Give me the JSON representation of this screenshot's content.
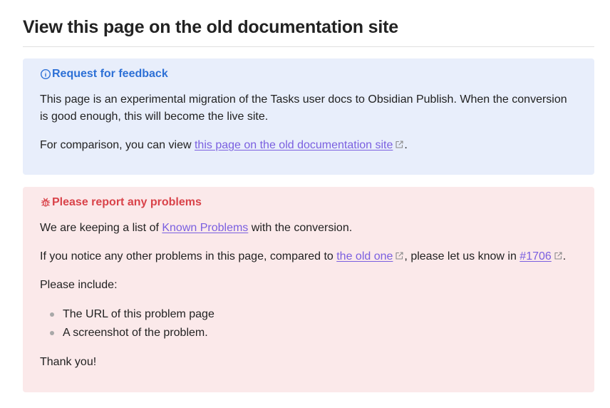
{
  "page": {
    "title": "View this page on the old documentation site"
  },
  "feedback_callout": {
    "icon": "info-icon",
    "title": "Request for feedback",
    "paragraph1": "This page is an experimental migration of the Tasks user docs to Obsidian Publish. When the conversion is good enough, this will become the live site.",
    "paragraph2_prefix": "For comparison, you can view ",
    "paragraph2_link": "this page on the old documentation site",
    "paragraph2_suffix": ".",
    "accent_color": "#2d70d6",
    "background_color": "#e8eefb"
  },
  "problems_callout": {
    "icon": "bug-icon",
    "title": "Please report any problems",
    "line1_prefix": "We are keeping a list of ",
    "line1_link": "Known Problems",
    "line1_suffix": " with the conversion.",
    "line2_prefix": "If you notice any other problems in this page, compared to ",
    "line2_link1": "the old one",
    "line2_middle": ", please let us know in ",
    "line2_link2": "#1706",
    "line2_suffix": ".",
    "line3": "Please include:",
    "bullets": [
      "The URL of this problem page",
      "A screenshot of the problem."
    ],
    "closing": "Thank you!",
    "accent_color": "#d9434a",
    "background_color": "#fbe9ea"
  },
  "link_color": "#7a5fe0"
}
